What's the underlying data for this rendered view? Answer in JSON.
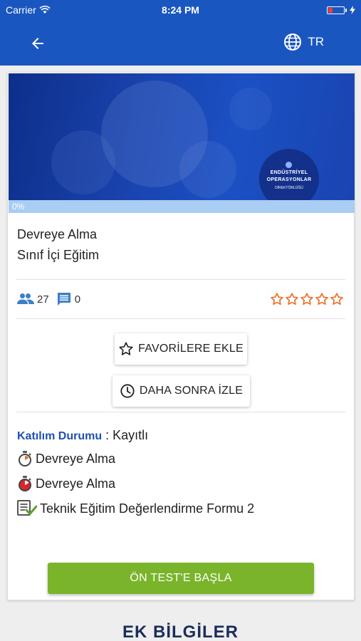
{
  "status_bar": {
    "carrier": "Carrier",
    "time": "8:24 PM"
  },
  "app_bar": {
    "back_icon": "arrow-left-icon",
    "language": "TR",
    "language_icon": "globe-icon"
  },
  "course": {
    "banner_logo": {
      "line1": "ENDÜSTRİYEL",
      "line2": "OPERASYONLAR",
      "line3": "DİREKTÖRLÜĞÜ"
    },
    "progress": {
      "label": "0%",
      "value": 0
    },
    "title_line1": "Devreye Alma",
    "title_line2": "Sınıf İçi Eğitim",
    "participants": "27",
    "comments": "0",
    "rating": {
      "value": 0,
      "max": 5
    }
  },
  "actions": {
    "favorite_label": "FAVORİLERE EKLE",
    "watch_later_label": "DAHA SONRA İZLE"
  },
  "enrollment": {
    "label": "Katılım Durumu",
    "separator": " : ",
    "value": "Kayıtlı"
  },
  "content_items": [
    {
      "label": "Devreye Alma",
      "icon": "stopwatch-icon"
    },
    {
      "label": "Devreye Alma",
      "icon": "stopwatch-red-icon"
    },
    {
      "label": "Teknik Eğitim Değerlendirme Formu 2",
      "icon": "form-check-icon"
    }
  ],
  "start_button_label": "ÖN TEST'E BAŞLA",
  "section_heading": "EK BİLGİLER",
  "colors": {
    "primary": "#1a56c0",
    "accent_green": "#7ab42b",
    "star_orange": "#e8702a",
    "link_blue": "#1e50b0"
  }
}
